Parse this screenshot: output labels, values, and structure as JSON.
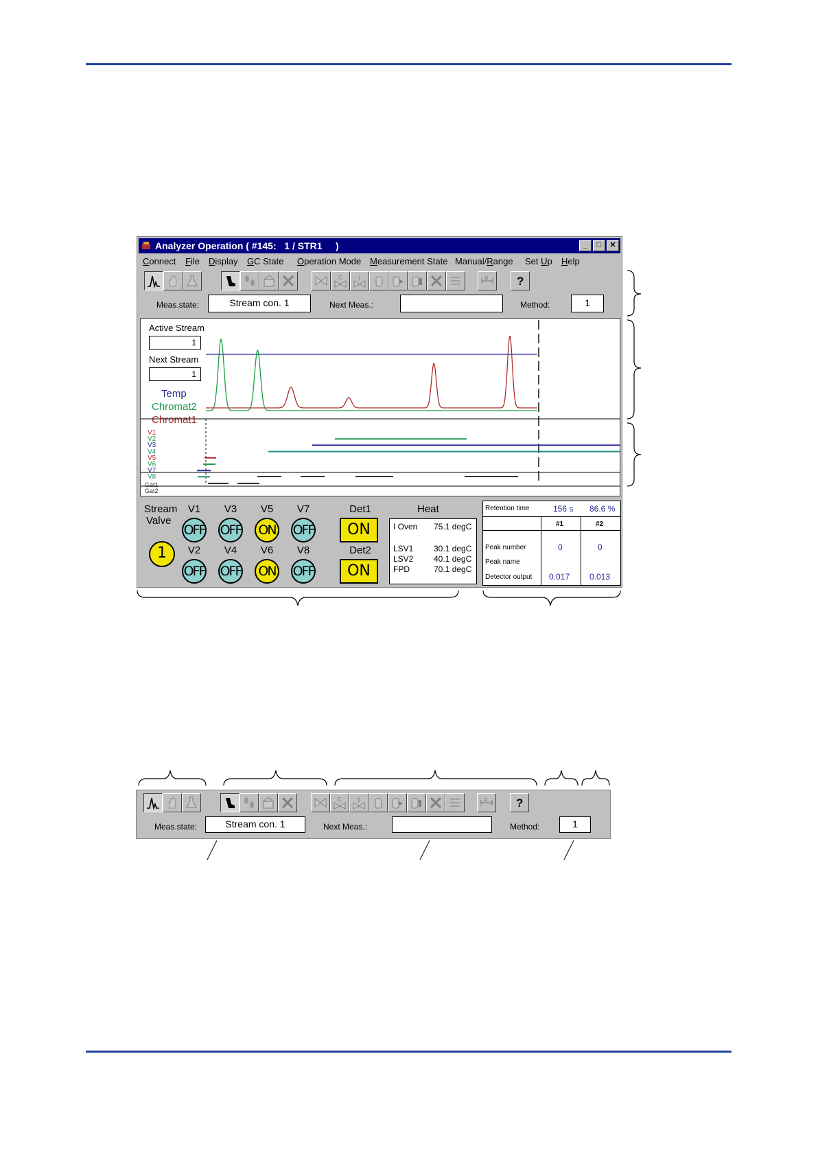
{
  "window": {
    "title": "Analyzer Operation ( #145:   1 / STR1     )",
    "menu": [
      "Connect",
      "File",
      "Display",
      "GC State",
      "Operation Mode",
      "Measurement State",
      "Manual/Range",
      "Set Up",
      "Help"
    ],
    "menu_shortcut_letters": [
      "C",
      "F",
      "D",
      "G",
      "O",
      "M",
      "R",
      "U",
      "H"
    ]
  },
  "toolbar": {
    "icons": [
      "chromatogram-icon",
      "hand-icon",
      "flask-icon",
      "boot-icon",
      "footprints-icon",
      "building-icon",
      "cancel-x-icon",
      "valve-a-icon",
      "valve-c-icon",
      "valve-1-icon",
      "cylinder-icon",
      "cylinder-arrow-icon",
      "cylinder-stop-icon",
      "cancel-x-icon",
      "list-icon",
      "range-icon",
      "help-icon"
    ]
  },
  "status": {
    "meas_state_label": "Meas.state:",
    "meas_state_value": "Stream con. 1",
    "next_meas_label": "Next Meas.:",
    "next_meas_value": "",
    "method_label": "Method:",
    "method_value": "1"
  },
  "chart": {
    "active_stream_label": "Active Stream",
    "active_stream_value": "1",
    "next_stream_label": "Next Stream",
    "next_stream_value": "1",
    "legend": [
      {
        "name": "Temp",
        "color": "#2b2b9c"
      },
      {
        "name": "Chromat2",
        "color": "#1f9a4a"
      },
      {
        "name": "Chromat1",
        "color": "#b02a2a"
      }
    ],
    "valve_labels": [
      "V1",
      "V2",
      "V3",
      "V4",
      "V5",
      "V6",
      "V7",
      "V8"
    ],
    "valve_colors": [
      "#b02a2a",
      "#1f9a4a",
      "#2b2b9c",
      "#1f8c7c",
      "#b02a2a",
      "#1f9a4a",
      "#2b2b9c",
      "#1f8c7c"
    ],
    "gate_labels": [
      "Gat1",
      "Gat2"
    ]
  },
  "chart_data": {
    "type": "line",
    "series": [
      {
        "color": "#b02a2a",
        "peaks": [
          0.28,
          0.47,
          0.75,
          1.0
        ]
      },
      {
        "color": "#1f9a4a",
        "peaks": [
          0.05,
          0.17
        ]
      },
      {
        "color": "#2b2b9c",
        "peaks": []
      }
    ]
  },
  "controls": {
    "stream_label": "Stream",
    "valve_label": "Valve",
    "stream_value": "1",
    "valves": [
      {
        "name": "V1",
        "state": "OFF"
      },
      {
        "name": "V3",
        "state": "OFF"
      },
      {
        "name": "V5",
        "state": "ON"
      },
      {
        "name": "V7",
        "state": "OFF"
      },
      {
        "name": "V2",
        "state": "OFF"
      },
      {
        "name": "V4",
        "state": "OFF"
      },
      {
        "name": "V6",
        "state": "ON"
      },
      {
        "name": "V8",
        "state": "OFF"
      }
    ],
    "det1_label": "Det1",
    "det1_state": "ON",
    "det2_label": "Det2",
    "det2_state": "ON",
    "heat_title": "Heat",
    "heat": [
      {
        "name": "I  Oven",
        "value": "75.1 degC"
      },
      {
        "name": "LSV1",
        "value": "30.1 degC"
      },
      {
        "name": "LSV2",
        "value": "40.1 degC"
      },
      {
        "name": "FPD",
        "value": "70.1 degC"
      }
    ]
  },
  "retention": {
    "label": "Retention time",
    "time": "156  s",
    "percent": "86.6 %",
    "col1": "#1",
    "col2": "#2",
    "peak_number_label": "Peak number",
    "peak_name_label": "Peak name",
    "detector_output_label": "Detector output",
    "peak_number_1": "0",
    "peak_number_2": "0",
    "detector_output_1": "0.017",
    "detector_output_2": "0.013"
  },
  "colors": {
    "rule": "#2244a0",
    "title_bar": "#000080",
    "window_face": "#c0c0c0",
    "valve_off": "#8ed1cf",
    "on_state": "#f2e600"
  }
}
